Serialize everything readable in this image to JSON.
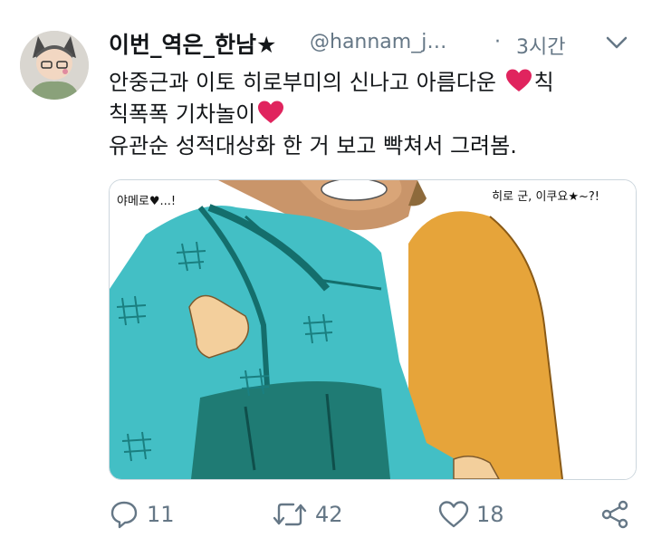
{
  "tweet": {
    "display_name": "이번_역은_한남★",
    "handle": "@hannam_j…",
    "separator": "·",
    "time": "3시간",
    "text_line1": "안중근과 이토 히로부미의 신나고 아름다운",
    "text_line1_after": "칙",
    "text_line2": "칙폭폭 기차놀이",
    "text_line3": "유관순 성적대상화 한 거 보고 빡쳐서 그려봄.",
    "media": {
      "speech_left": "야메로♥...!",
      "speech_right": "히로 군, 이쿠요★~?!"
    },
    "actions": {
      "reply_count": "11",
      "retweet_count": "42",
      "like_count": "18"
    }
  },
  "icons": {
    "inline_heart": "red-heart-icon",
    "chevron": "chevron-down-icon",
    "reply": "reply-icon",
    "retweet": "retweet-icon",
    "like": "heart-outline-icon",
    "share": "share-icon"
  },
  "colors": {
    "text_primary": "#14171a",
    "text_secondary": "#657786",
    "heart_red": "#e0245e",
    "border": "#ccd6dd"
  }
}
